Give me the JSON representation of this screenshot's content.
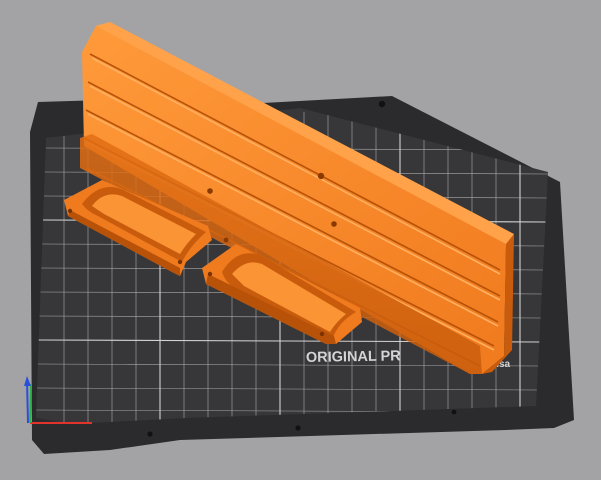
{
  "viewport": {
    "background": "#a3a3a6",
    "bed": {
      "brand_text": "ORIGINAL PR",
      "brand_suffix": "rusa",
      "plate_color": "#37373a",
      "frame_color": "#2b2b2e",
      "grid_color": "#bfbfbf"
    },
    "models": [
      {
        "name": "comb-panel",
        "color": "#f07a1e"
      },
      {
        "name": "half-pipe-clip-left",
        "color": "#f07a1e"
      },
      {
        "name": "half-pipe-clip-right",
        "color": "#f07a1e"
      }
    ],
    "axes": {
      "x_color": "#e0332c",
      "y_color": "#2fb24a",
      "z_color": "#2a4fd8",
      "x_icon": "x-axis-icon",
      "y_icon": "y-axis-icon",
      "z_icon": "z-axis-icon"
    }
  }
}
